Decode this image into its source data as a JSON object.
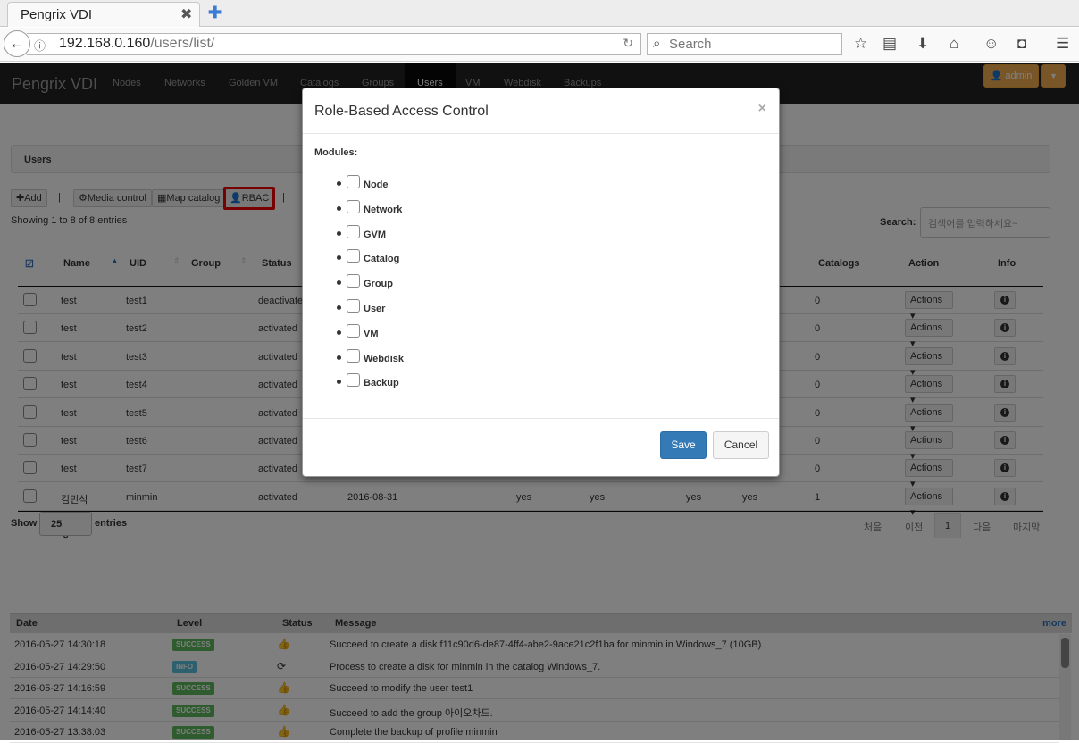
{
  "browser": {
    "tab_title": "Pengrix VDI",
    "tab_close": "✖",
    "new_tab": "✚",
    "url_host": "192.168.0.160",
    "url_path": "/users/list/",
    "search_placeholder": "Search"
  },
  "app": {
    "brand": "Pengrix VDI",
    "nav": [
      "Nodes",
      "Networks",
      "Golden VM",
      "Catalogs",
      "Groups",
      "Users",
      "VM",
      "Webdisk",
      "Backups"
    ],
    "active_nav": "Users",
    "admin_label": "admin"
  },
  "page": {
    "panel_title": "Users",
    "buttons": {
      "add": "Add",
      "media": "Media control",
      "map": "Map catalog",
      "rbac": "RBAC"
    },
    "showing": "Showing 1 to 8 of 8 entries",
    "search_label": "Search:",
    "search_placeholder": "검색어를 입력하세요~",
    "columns": {
      "name": "Name",
      "uid": "UID",
      "group": "Group",
      "status": "Status",
      "catalogs": "Catalogs",
      "action": "Action",
      "info": "Info"
    },
    "action_label": "Actions",
    "rows": [
      {
        "name": "test",
        "uid": "test1",
        "status": "deactivated",
        "created": "",
        "c1": "",
        "c2": "",
        "c3": "",
        "c4": "",
        "catalogs": "0"
      },
      {
        "name": "test",
        "uid": "test2",
        "status": "activated",
        "created": "",
        "c1": "",
        "c2": "",
        "c3": "",
        "c4": "",
        "catalogs": "0"
      },
      {
        "name": "test",
        "uid": "test3",
        "status": "activated",
        "created": "",
        "c1": "",
        "c2": "",
        "c3": "",
        "c4": "",
        "catalogs": "0"
      },
      {
        "name": "test",
        "uid": "test4",
        "status": "activated",
        "created": "",
        "c1": "",
        "c2": "",
        "c3": "",
        "c4": "",
        "catalogs": "0"
      },
      {
        "name": "test",
        "uid": "test5",
        "status": "activated",
        "created": "",
        "c1": "",
        "c2": "",
        "c3": "",
        "c4": "",
        "catalogs": "0"
      },
      {
        "name": "test",
        "uid": "test6",
        "status": "activated",
        "created": "",
        "c1": "",
        "c2": "",
        "c3": "",
        "c4": "",
        "catalogs": "0"
      },
      {
        "name": "test",
        "uid": "test7",
        "status": "activated",
        "created": "",
        "c1": "",
        "c2": "",
        "c3": "",
        "c4": "",
        "catalogs": "0"
      },
      {
        "name": "김민석",
        "uid": "minmin",
        "status": "activated",
        "created": "2016-08-31",
        "c1": "yes",
        "c2": "yes",
        "c3": "yes",
        "c4": "yes",
        "catalogs": "1"
      }
    ],
    "show_label": "Show",
    "show_value": "25",
    "entries_label": "entries",
    "pagination": {
      "first": "처음",
      "prev": "이전",
      "current": "1",
      "next": "다음",
      "last": "마지막"
    }
  },
  "log": {
    "headers": {
      "date": "Date",
      "level": "Level",
      "status": "Status",
      "message": "Message"
    },
    "more": "more",
    "rows": [
      {
        "date": "2016-05-27 14:30:18",
        "level": "SUCCESS",
        "status_icon": "👍",
        "message": "Succeed to create a disk f11c90d6-de87-4ff4-abe2-9ace21c2f1ba for minmin in Windows_7 (10GB)"
      },
      {
        "date": "2016-05-27 14:29:50",
        "level": "INFO",
        "status_icon": "⟳",
        "message": "Process to create a disk for minmin in the catalog Windows_7."
      },
      {
        "date": "2016-05-27 14:16:59",
        "level": "SUCCESS",
        "status_icon": "👍",
        "message": "Succeed to modify the user test1"
      },
      {
        "date": "2016-05-27 14:14:40",
        "level": "SUCCESS",
        "status_icon": "👍",
        "message": "Succeed to add the group 아이오차드."
      },
      {
        "date": "2016-05-27 13:38:03",
        "level": "SUCCESS",
        "status_icon": "👍",
        "message": "Complete the backup of profile minmin"
      }
    ]
  },
  "modal": {
    "title": "Role-Based Access Control",
    "close": "×",
    "modules_label": "Modules:",
    "modules": [
      "Node",
      "Network",
      "GVM",
      "Catalog",
      "Group",
      "User",
      "VM",
      "Webdisk",
      "Backup"
    ],
    "save": "Save",
    "cancel": "Cancel"
  }
}
